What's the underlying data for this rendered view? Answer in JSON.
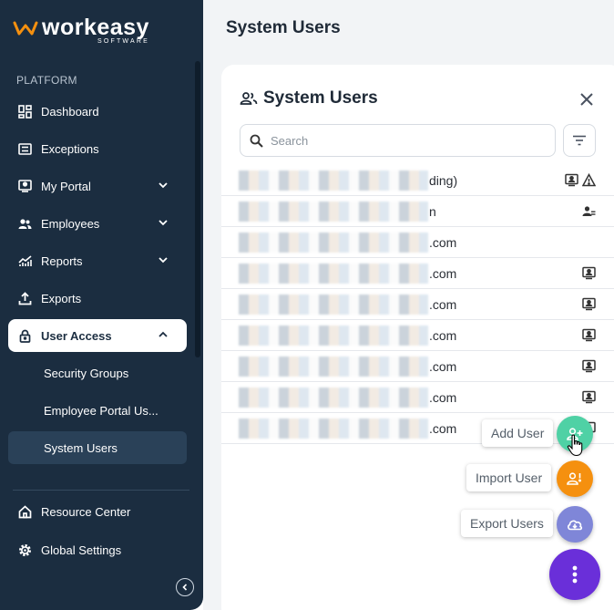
{
  "brand": {
    "name": "workeasy",
    "sub": "SOFTWARE"
  },
  "sidebar": {
    "section": "PLATFORM",
    "items": [
      {
        "label": "Dashboard",
        "icon": "dashboard-icon"
      },
      {
        "label": "Exceptions",
        "icon": "list-icon"
      },
      {
        "label": "My Portal",
        "icon": "portal-icon",
        "expandable": true
      },
      {
        "label": "Employees",
        "icon": "users-icon",
        "expandable": true
      },
      {
        "label": "Reports",
        "icon": "chart-icon",
        "expandable": true
      },
      {
        "label": "Exports",
        "icon": "upload-icon"
      },
      {
        "label": "User Access",
        "icon": "lock-icon",
        "expanded": true
      }
    ],
    "sub_items": [
      {
        "label": "Security Groups"
      },
      {
        "label": "Employee Portal Us..."
      },
      {
        "label": "System Users"
      }
    ],
    "footer_items": [
      {
        "label": "Resource Center",
        "icon": "home-icon"
      },
      {
        "label": "Global Settings",
        "icon": "gear-icon"
      }
    ]
  },
  "main": {
    "page_title": "System Users",
    "panel_title": "System Users",
    "search_placeholder": "Search",
    "rows": [
      {
        "tail": "ding)",
        "icons": [
          "portal-icon",
          "warning-icon"
        ]
      },
      {
        "tail": "n",
        "icons": [
          "user-admin-icon"
        ]
      },
      {
        "tail": ".com",
        "icons": []
      },
      {
        "tail": ".com",
        "icons": [
          "portal-icon"
        ]
      },
      {
        "tail": ".com",
        "icons": [
          "portal-icon"
        ]
      },
      {
        "tail": ".com",
        "icons": [
          "portal-icon"
        ]
      },
      {
        "tail": ".com",
        "icons": [
          "portal-icon"
        ]
      },
      {
        "tail": ".com",
        "icons": [
          "portal-icon"
        ]
      },
      {
        "tail": ".com",
        "icons": [
          "portal-icon"
        ]
      }
    ]
  },
  "fab_menu": {
    "add_user": "Add User",
    "import_user": "Import User",
    "export_users": "Export Users"
  },
  "colors": {
    "sidebar": "#1b2d40",
    "add": "#4fd1a5",
    "import": "#f5900f",
    "export": "#7f86d8",
    "main_fab": "#6a2fd9",
    "logo_orange": "#f5900f"
  }
}
